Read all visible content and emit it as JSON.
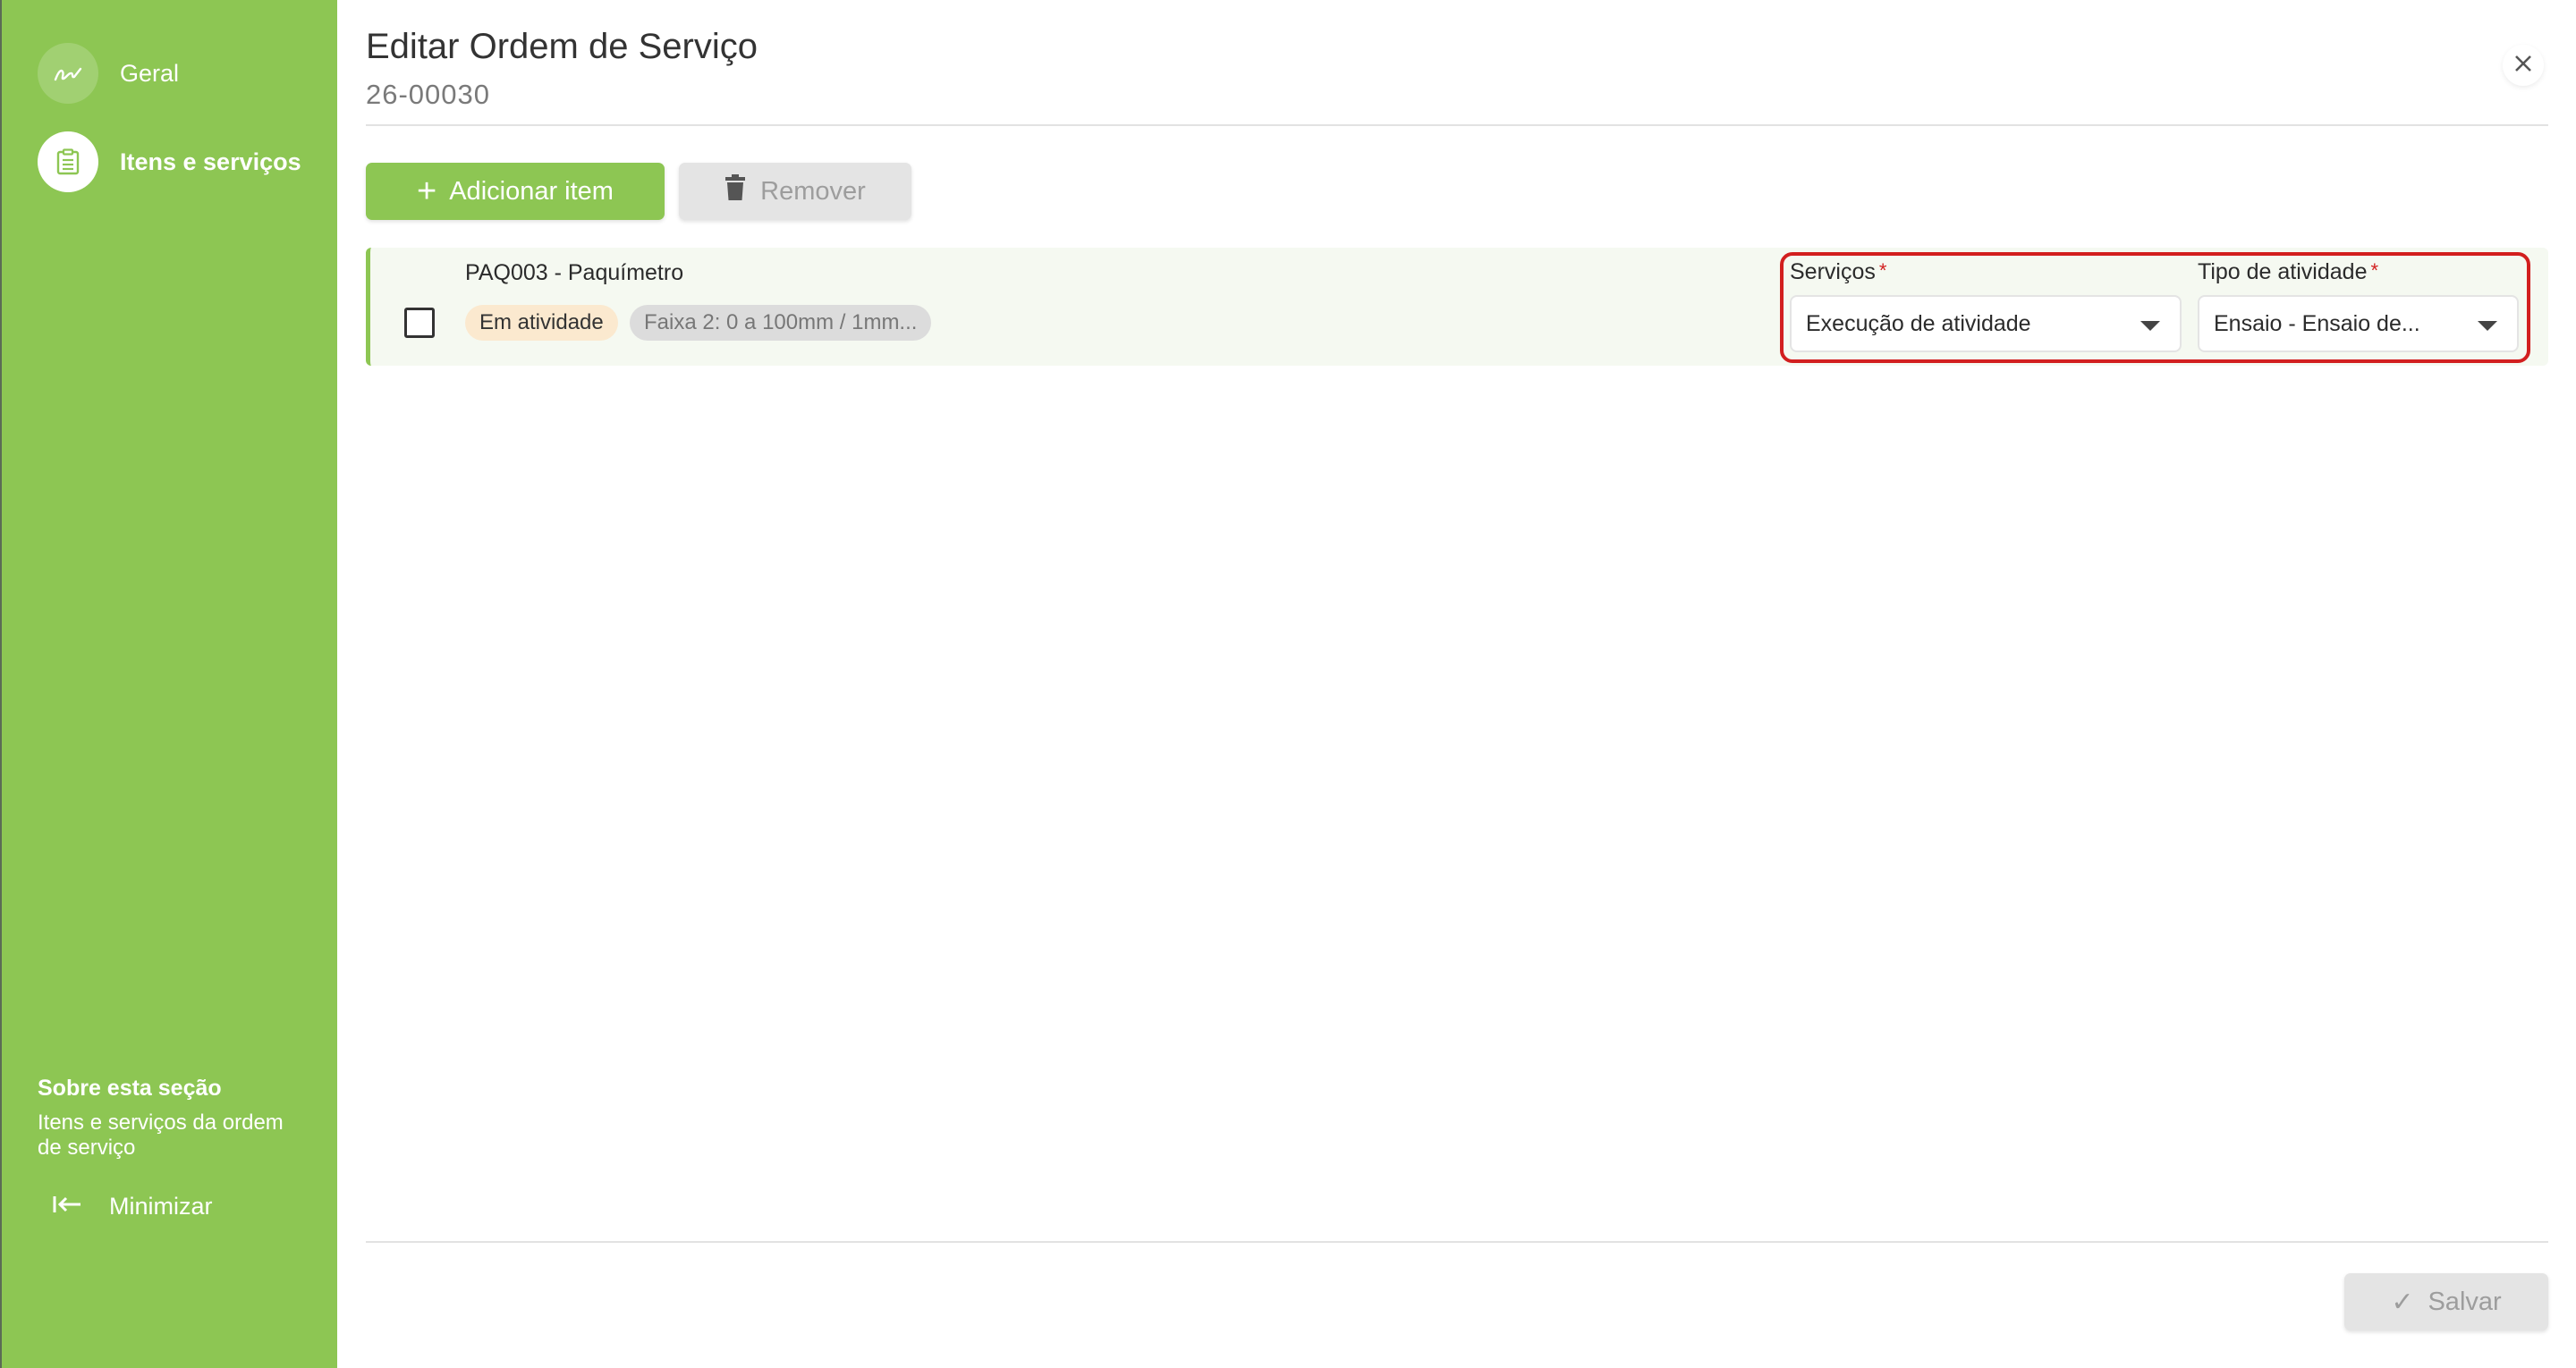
{
  "sidebar": {
    "items": [
      {
        "label": "Geral",
        "icon": "signature-icon"
      },
      {
        "label": "Itens e serviços",
        "icon": "clipboard-icon"
      }
    ],
    "about": {
      "title": "Sobre esta seção",
      "description": "Itens e serviços da ordem de serviço"
    },
    "minimize_label": "Minimizar"
  },
  "header": {
    "title": "Editar Ordem de Serviço",
    "subtitle": "26-00030"
  },
  "toolbar": {
    "add_label": "Adicionar item",
    "remove_label": "Remover"
  },
  "items": [
    {
      "name": "PAQ003 - Paquímetro",
      "status": "Em atividade",
      "range": "Faixa 2: 0 a 100mm / 1mm...",
      "servicos": {
        "label": "Serviços",
        "required_mark": "*",
        "value": "Execução de atividade"
      },
      "tipo_atividade": {
        "label": "Tipo de atividade",
        "required_mark": "*",
        "value": "Ensaio - Ensaio de..."
      }
    }
  ],
  "footer": {
    "save_label": "Salvar"
  },
  "colors": {
    "accent": "#8dc653",
    "highlight": "#d21f1f",
    "status_chip": "#fbe9cf",
    "disabled": "#e4e4e4"
  }
}
